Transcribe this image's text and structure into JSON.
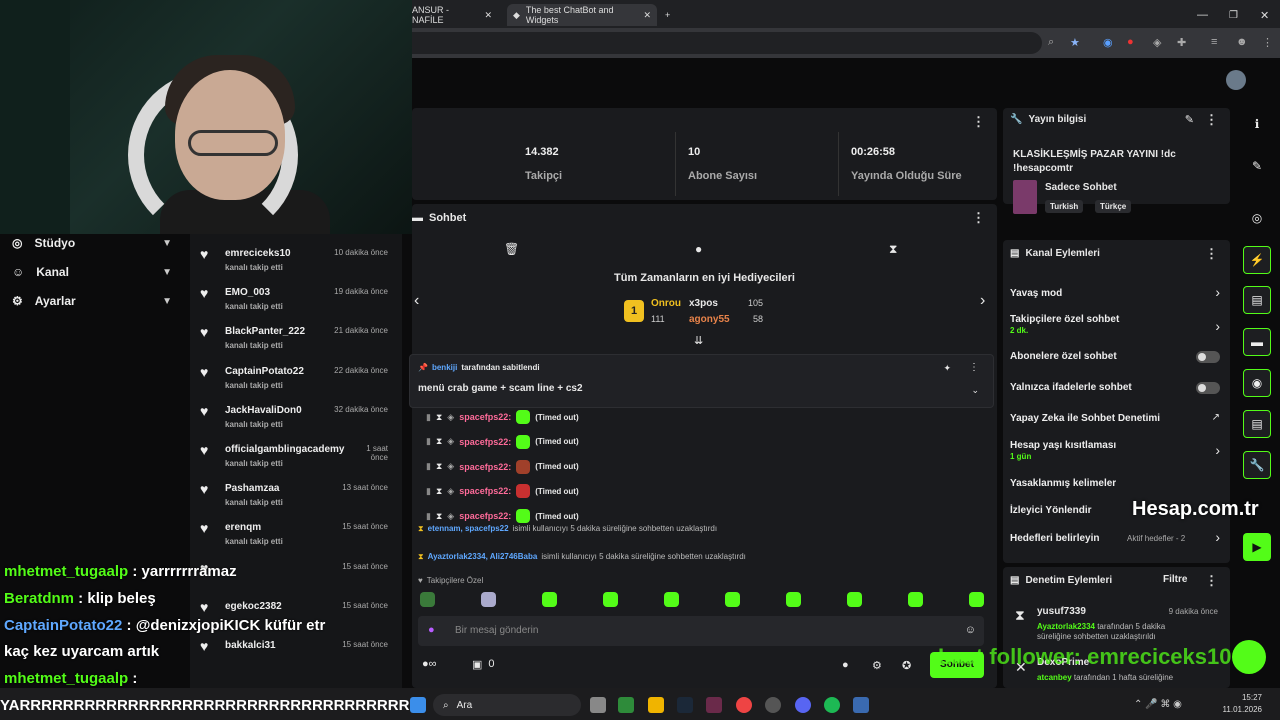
{
  "browser": {
    "tabs": [
      {
        "label": "ANSUR - NAFİLE"
      },
      {
        "label": "The best ChatBot and Widgets"
      }
    ]
  },
  "left_nav": [
    {
      "label": "Stüdyo",
      "icon": "studio-icon"
    },
    {
      "label": "Kanal",
      "icon": "users-icon"
    },
    {
      "label": "Ayarlar",
      "icon": "gear-icon"
    }
  ],
  "followers": [
    {
      "name": "emreciceks10",
      "sub": "kanalı takip etti",
      "time": "10 dakika önce"
    },
    {
      "name": "EMO_003",
      "sub": "kanalı takip etti",
      "time": "19 dakika önce"
    },
    {
      "name": "BlackPanter_222",
      "sub": "kanalı takip etti",
      "time": "21 dakika önce"
    },
    {
      "name": "CaptainPotato22",
      "sub": "kanalı takip etti",
      "time": "22 dakika önce"
    },
    {
      "name": "JackHavaliDon0",
      "sub": "kanalı takip etti",
      "time": "32 dakika önce"
    },
    {
      "name": "officialgamblingacademy",
      "sub": "kanalı takip etti",
      "time": "1 saat önce"
    },
    {
      "name": "Pashamzaa",
      "sub": "kanalı takip etti",
      "time": "13 saat önce"
    },
    {
      "name": "erenqm",
      "sub": "kanalı takip etti",
      "time": "15 saat önce"
    },
    {
      "name": "",
      "sub": "",
      "time": "15 saat önce"
    },
    {
      "name": "egekoc2382",
      "sub": "",
      "time": "15 saat önce"
    },
    {
      "name": "bakkalci31",
      "sub": "",
      "time": "15 saat önce"
    }
  ],
  "overlay_chat": [
    {
      "user": "mhetmet_tugaalp",
      "text": " : yarrrrrrramaz",
      "color": "#53fc18"
    },
    {
      "user": "Beratdnm",
      "text": " : klip beleş",
      "color": "#53fc18"
    },
    {
      "user": "CaptainPotato22",
      "text": " : @denizxjopiKICK küfür etr",
      "color": "#5fa8ff"
    },
    {
      "user": "",
      "text": "kaç kez uyarcam artık",
      "color": "#ffffff"
    },
    {
      "user": "mhetmet_tugaalp",
      "text": " :",
      "color": "#53fc18"
    },
    {
      "user": "",
      "text": "YARRRRRRRRRRRRRRRRRRRRRRRRRRRRRRRRRRRR",
      "color": "#ffffff"
    }
  ],
  "stats": [
    {
      "value": "14.382",
      "label": "Takipçi"
    },
    {
      "value": "10",
      "label": "Abone Sayısı"
    },
    {
      "value": "00:26:58",
      "label": "Yayında Olduğu Süre"
    }
  ],
  "chat": {
    "title": "Sohbet",
    "gifters_title": "Tüm Zamanların en iyi Hediyecileri",
    "gifters": [
      {
        "name": "Onrou",
        "amount": "111"
      },
      {
        "name": "x3pos",
        "amount": "105"
      },
      {
        "name": "agony55",
        "amount": "58"
      }
    ],
    "pinned_by": "benkiji",
    "pinned_suffix": "tarafından sabitlendi",
    "pinned_text": "menü crab game + scam line + cs2",
    "messages": [
      {
        "user": "spacefps22:",
        "status": "(Timed out)"
      },
      {
        "user": "spacefps22:",
        "status": "(Timed out)"
      },
      {
        "user": "spacefps22:",
        "status": "(Timed out)"
      },
      {
        "user": "spacefps22:",
        "status": "(Timed out)"
      },
      {
        "user": "spacefps22:",
        "status": "(Timed out)"
      }
    ],
    "notice1_users": "etennam, spacefps22",
    "notice1_text": "isimli kullanıcıyı 5 dakika süreliğine sohbetten uzaklaştırdı",
    "notice2_users": "Ayaztorlak2334, Ali2746Baba",
    "notice2_text": "isimli kullanıcıyı 5 dakika süreliğine sohbetten uzaklaştırdı",
    "emote_section": "Takipçilere Özel",
    "input_placeholder": "Bir mesaj gönderin",
    "viewer_count": "0",
    "send_label": "Sohbet"
  },
  "stream_info": {
    "title": "Yayın bilgisi",
    "stream_title": "KLASİKLEŞMİŞ PAZAR YAYINI !dc !hesapcomtr",
    "category": "Sadece Sohbet",
    "tags": [
      "Turkish",
      "Türkçe"
    ]
  },
  "channel_actions": {
    "title": "Kanal Eylemleri",
    "items": [
      {
        "label": "Yavaş mod",
        "sub": ""
      },
      {
        "label": "Takipçilere özel sohbet",
        "sub": "2 dk."
      },
      {
        "label": "Abonelere özel sohbet",
        "sub": ""
      },
      {
        "label": "Yalnızca ifadelerle sohbet",
        "sub": ""
      },
      {
        "label": "Yapay Zeka ile Sohbet Denetimi",
        "sub": ""
      },
      {
        "label": "Hesap yaşı kısıtlaması",
        "sub": "1 gün"
      },
      {
        "label": "Yasaklanmış kelimeler",
        "sub": ""
      },
      {
        "label": "İzleyici Yönlendir",
        "sub": ""
      },
      {
        "label": "Hedefleri belirleyin",
        "sub": "Aktif hedefler - 2"
      }
    ]
  },
  "mod_actions": {
    "title": "Denetim Eylemleri",
    "filter": "Filtre",
    "items": [
      {
        "user": "yusuf7339",
        "time": "9 dakika önce",
        "by": "Ayaztorlak2334",
        "text": "tarafından 5 dakika süreliğine sohbetten uzaklaştırıldı"
      },
      {
        "user": "DexoPrime",
        "time": "",
        "by": "atcanbey",
        "text": "tarafından 1 hafta süreliğine"
      }
    ]
  },
  "overlays": {
    "watermark": "Hesap.com.tr",
    "last_follower": "Last follower: emreciceks10"
  },
  "taskbar": {
    "search": "Ara",
    "time": "15:27",
    "date": "11.01.2026"
  },
  "colors": {
    "accent": "#53fc18",
    "panel": "#1a1b1e",
    "bg": "#0b0b0c"
  }
}
